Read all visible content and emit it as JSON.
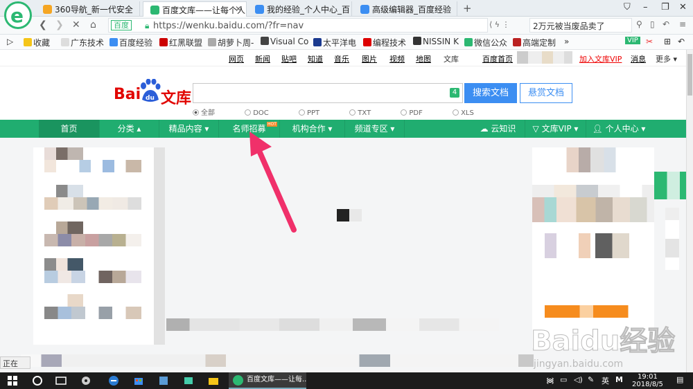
{
  "tabs": [
    {
      "title": "360导航_新一代安全",
      "icon_color": "#f5a623"
    },
    {
      "title": "百度文库——让每个人",
      "icon_color": "#2cb872",
      "active": true
    },
    {
      "title": "我的经验_个人中心_百",
      "icon_color": "#3c8ef2"
    },
    {
      "title": "高级编辑器_百度经验",
      "icon_color": "#3c8ef2"
    }
  ],
  "addressbar": {
    "badge": "百度",
    "url_host": "https://wenku.baidu.com",
    "url_path": "/?fr=nav",
    "search_text": "2万元被当废品卖了"
  },
  "bookmarks": [
    {
      "label": "收藏",
      "color": "#f5c518"
    },
    {
      "label": "广东技术",
      "color": "#ccc"
    },
    {
      "label": "百度经验",
      "color": "#3c8ef2"
    },
    {
      "label": "红黑联盟",
      "color": "#c00"
    },
    {
      "label": "胡萝卜周-",
      "color": "#aaa"
    },
    {
      "label": "Visual Co",
      "color": "#444"
    },
    {
      "label": "太平洋电",
      "color": "#1b3a8f"
    },
    {
      "label": "编程技术",
      "color": "#d00"
    },
    {
      "label": "NISSIN K",
      "color": "#333"
    },
    {
      "label": "微信公众",
      "color": "#2cb872"
    },
    {
      "label": "高端定制",
      "color": "#b22"
    }
  ],
  "topnav": {
    "links": [
      "网页",
      "新闻",
      "贴吧",
      "知道",
      "音乐",
      "图片",
      "视频",
      "地图"
    ],
    "current": "文库",
    "home": "百度首页",
    "vip": "加入文库VIP",
    "msg": "消息",
    "more": "更多"
  },
  "search": {
    "badge_num": "4",
    "button": "搜索文档",
    "button2": "悬赏文档",
    "filters": [
      "全部",
      "DOC",
      "PPT",
      "TXT",
      "PDF",
      "XLS"
    ]
  },
  "logo": {
    "bai": "Bai",
    "du": "du",
    "wk": "文库"
  },
  "menu": {
    "items": [
      "首页",
      "分类",
      "精品内容",
      "名师招募",
      "机构合作",
      "频道专区"
    ],
    "hot": "HOT",
    "right": [
      "云知识",
      "文库VIP",
      "个人中心"
    ]
  },
  "status": "正在",
  "watermark": {
    "big": "Baidu经验",
    "small": "jingyan.baidu.com"
  },
  "taskbar": {
    "app_title": "百度文库——让每...",
    "ime": "英",
    "ime2": "M",
    "time": "19:01",
    "date": "2018/8/5"
  }
}
